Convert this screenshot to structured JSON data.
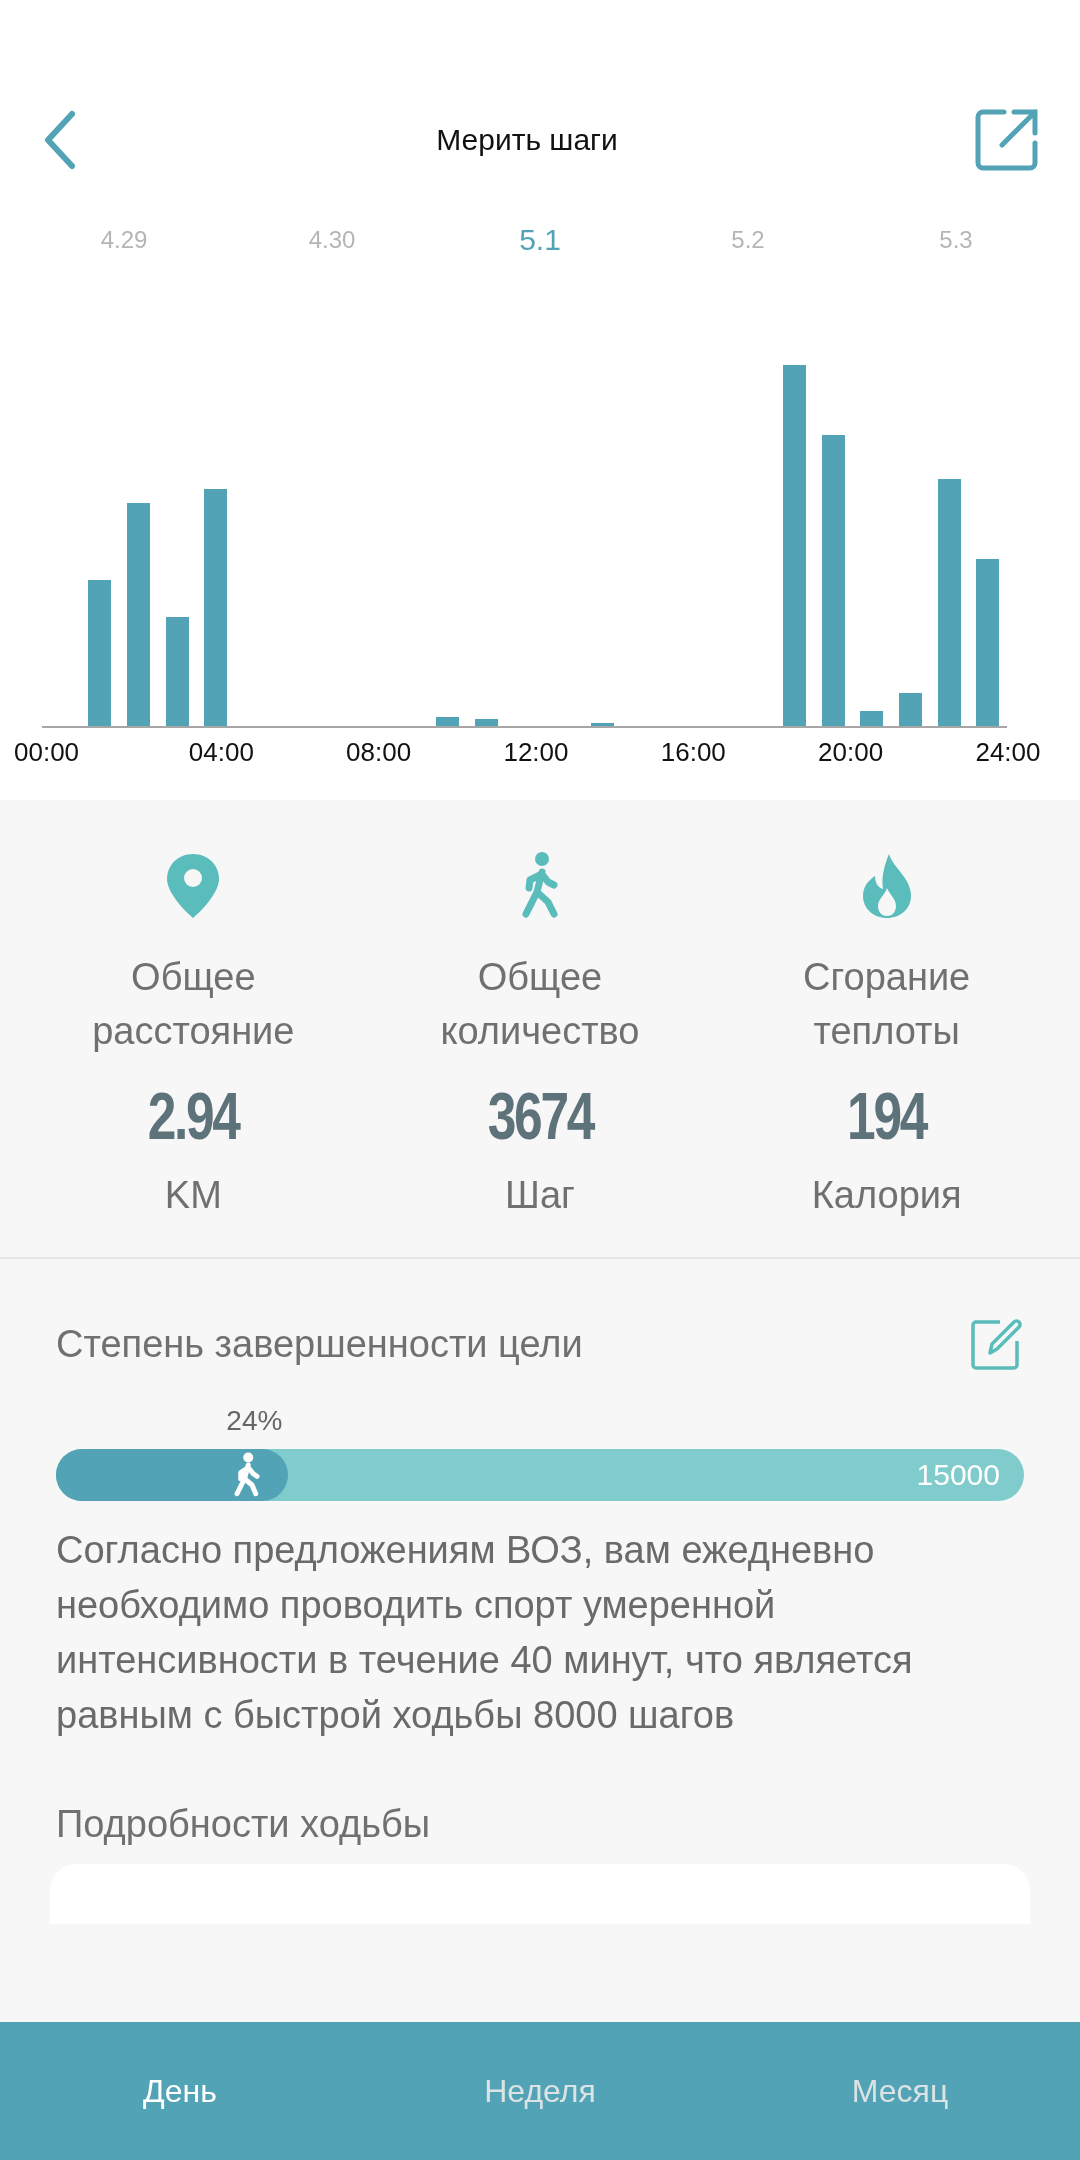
{
  "header": {
    "title": "Мерить шаги"
  },
  "dates": [
    {
      "label": "4.29",
      "selected": false
    },
    {
      "label": "4.30",
      "selected": false
    },
    {
      "label": "5.1",
      "selected": true
    },
    {
      "label": "5.2",
      "selected": false
    },
    {
      "label": "5.3",
      "selected": false
    }
  ],
  "chart": {
    "x_labels": [
      "00:00",
      "04:00",
      "08:00",
      "12:00",
      "16:00",
      "20:00",
      "24:00"
    ]
  },
  "stats": [
    {
      "kind": "distance",
      "label": "Общее расстояние",
      "value": "2.94",
      "unit": "KM"
    },
    {
      "kind": "steps",
      "label": "Общее количество",
      "value": "3674",
      "unit": "Шаг"
    },
    {
      "kind": "calories",
      "label": "Сгорание теплоты",
      "value": "194",
      "unit": "Калория"
    }
  ],
  "goal": {
    "title": "Степень завершенности цели",
    "percent": "24%",
    "level": 0.24,
    "target": "15000",
    "note": "Согласно предложениям ВОЗ, вам ежедневно необходимо проводить спорт умеренной интенсивности в течение 40 минут, что является равным с быстрой ходьбы 8000 шагов"
  },
  "details": {
    "title": "Подробности ходьбы"
  },
  "bottom_tabs": [
    {
      "label": "День",
      "selected": true
    },
    {
      "label": "Неделя",
      "selected": false
    },
    {
      "label": "Месяц",
      "selected": false
    }
  ]
}
